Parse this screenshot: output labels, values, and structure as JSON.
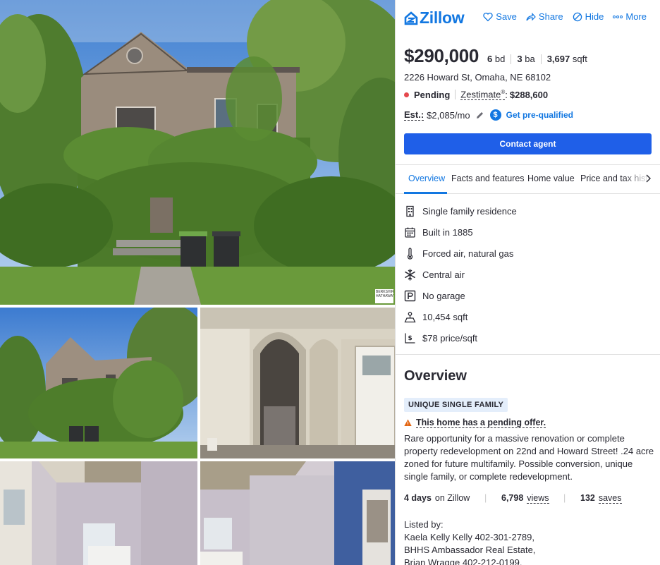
{
  "brand": {
    "name": "Zillow",
    "color": "#1277e1"
  },
  "actions": [
    {
      "label": "Save",
      "icon": "heart-icon"
    },
    {
      "label": "Share",
      "icon": "share-arrow-icon"
    },
    {
      "label": "Hide",
      "icon": "hide-icon"
    },
    {
      "label": "More",
      "icon": "more-dots-icon"
    }
  ],
  "listing": {
    "price": "$290,000",
    "beds_value": "6",
    "beds_unit": "bd",
    "baths_value": "3",
    "baths_unit": "ba",
    "sqft_value": "3,697",
    "sqft_unit": "sqft",
    "address": "2226 Howard St, Omaha, NE 68102",
    "status": "Pending",
    "status_color": "#e5484d",
    "zestimate_label": "Zestimate",
    "zestimate_value": "$288,600",
    "est_label": "Est.:",
    "est_value": "$2,085/mo",
    "prequal_label": "Get pre-qualified",
    "contact_label": "Contact agent"
  },
  "tabs": [
    "Overview",
    "Facts and features",
    "Home value",
    "Price and tax hist"
  ],
  "features": [
    {
      "icon": "building-icon",
      "text": "Single family residence"
    },
    {
      "icon": "calendar-icon",
      "text": "Built in 1885"
    },
    {
      "icon": "thermometer-icon",
      "text": "Forced air, natural gas"
    },
    {
      "icon": "snowflake-icon",
      "text": "Central air"
    },
    {
      "icon": "parking-icon",
      "text": "No garage"
    },
    {
      "icon": "lot-size-icon",
      "text": "10,454 sqft"
    },
    {
      "icon": "price-per-sqft-icon",
      "text": "$78 price/sqft"
    }
  ],
  "overview": {
    "title": "Overview",
    "tag": "UNIQUE SINGLE FAMILY",
    "pending_note": "This home has a pending offer.",
    "description": "Rare opportunity for a massive renovation or complete property redevelopment on 22nd and Howard Street! .24 acre zoned for future multifamily. Possible conversion, unique single family, or complete redevelopment.",
    "days_value": "4 days",
    "days_label": "on Zillow",
    "views_value": "6,798",
    "views_label": "views",
    "saves_value": "132",
    "saves_label": "saves",
    "listed_by": "Listed by:",
    "listed_lines": [
      "Kaela Kelly Kelly 402-301-2789,",
      "BHHS Ambassador Real Estate,",
      "Brian Wragge 402-212-0199,"
    ]
  },
  "watermark": "BERKSHIRE HATHAWAY"
}
